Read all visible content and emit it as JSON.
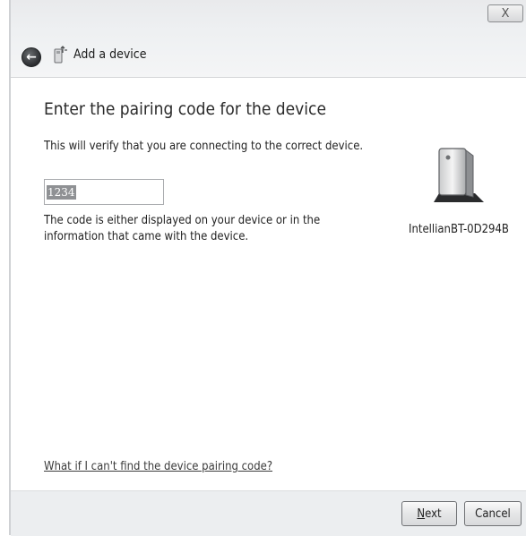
{
  "window": {
    "title": "Add a device",
    "close_label": "X"
  },
  "content": {
    "heading": "Enter the pairing code for the device",
    "description": "This will verify that you are connecting to the correct device.",
    "code_value": "1234",
    "hint": "The code is either displayed on your device or in the information that came with the device.",
    "help_link": "What if I can't find the device pairing code?"
  },
  "device": {
    "name": "IntellianBT-0D294B",
    "icon": "device-tower-icon"
  },
  "footer": {
    "next_label": "Next",
    "cancel_label": "Cancel"
  }
}
